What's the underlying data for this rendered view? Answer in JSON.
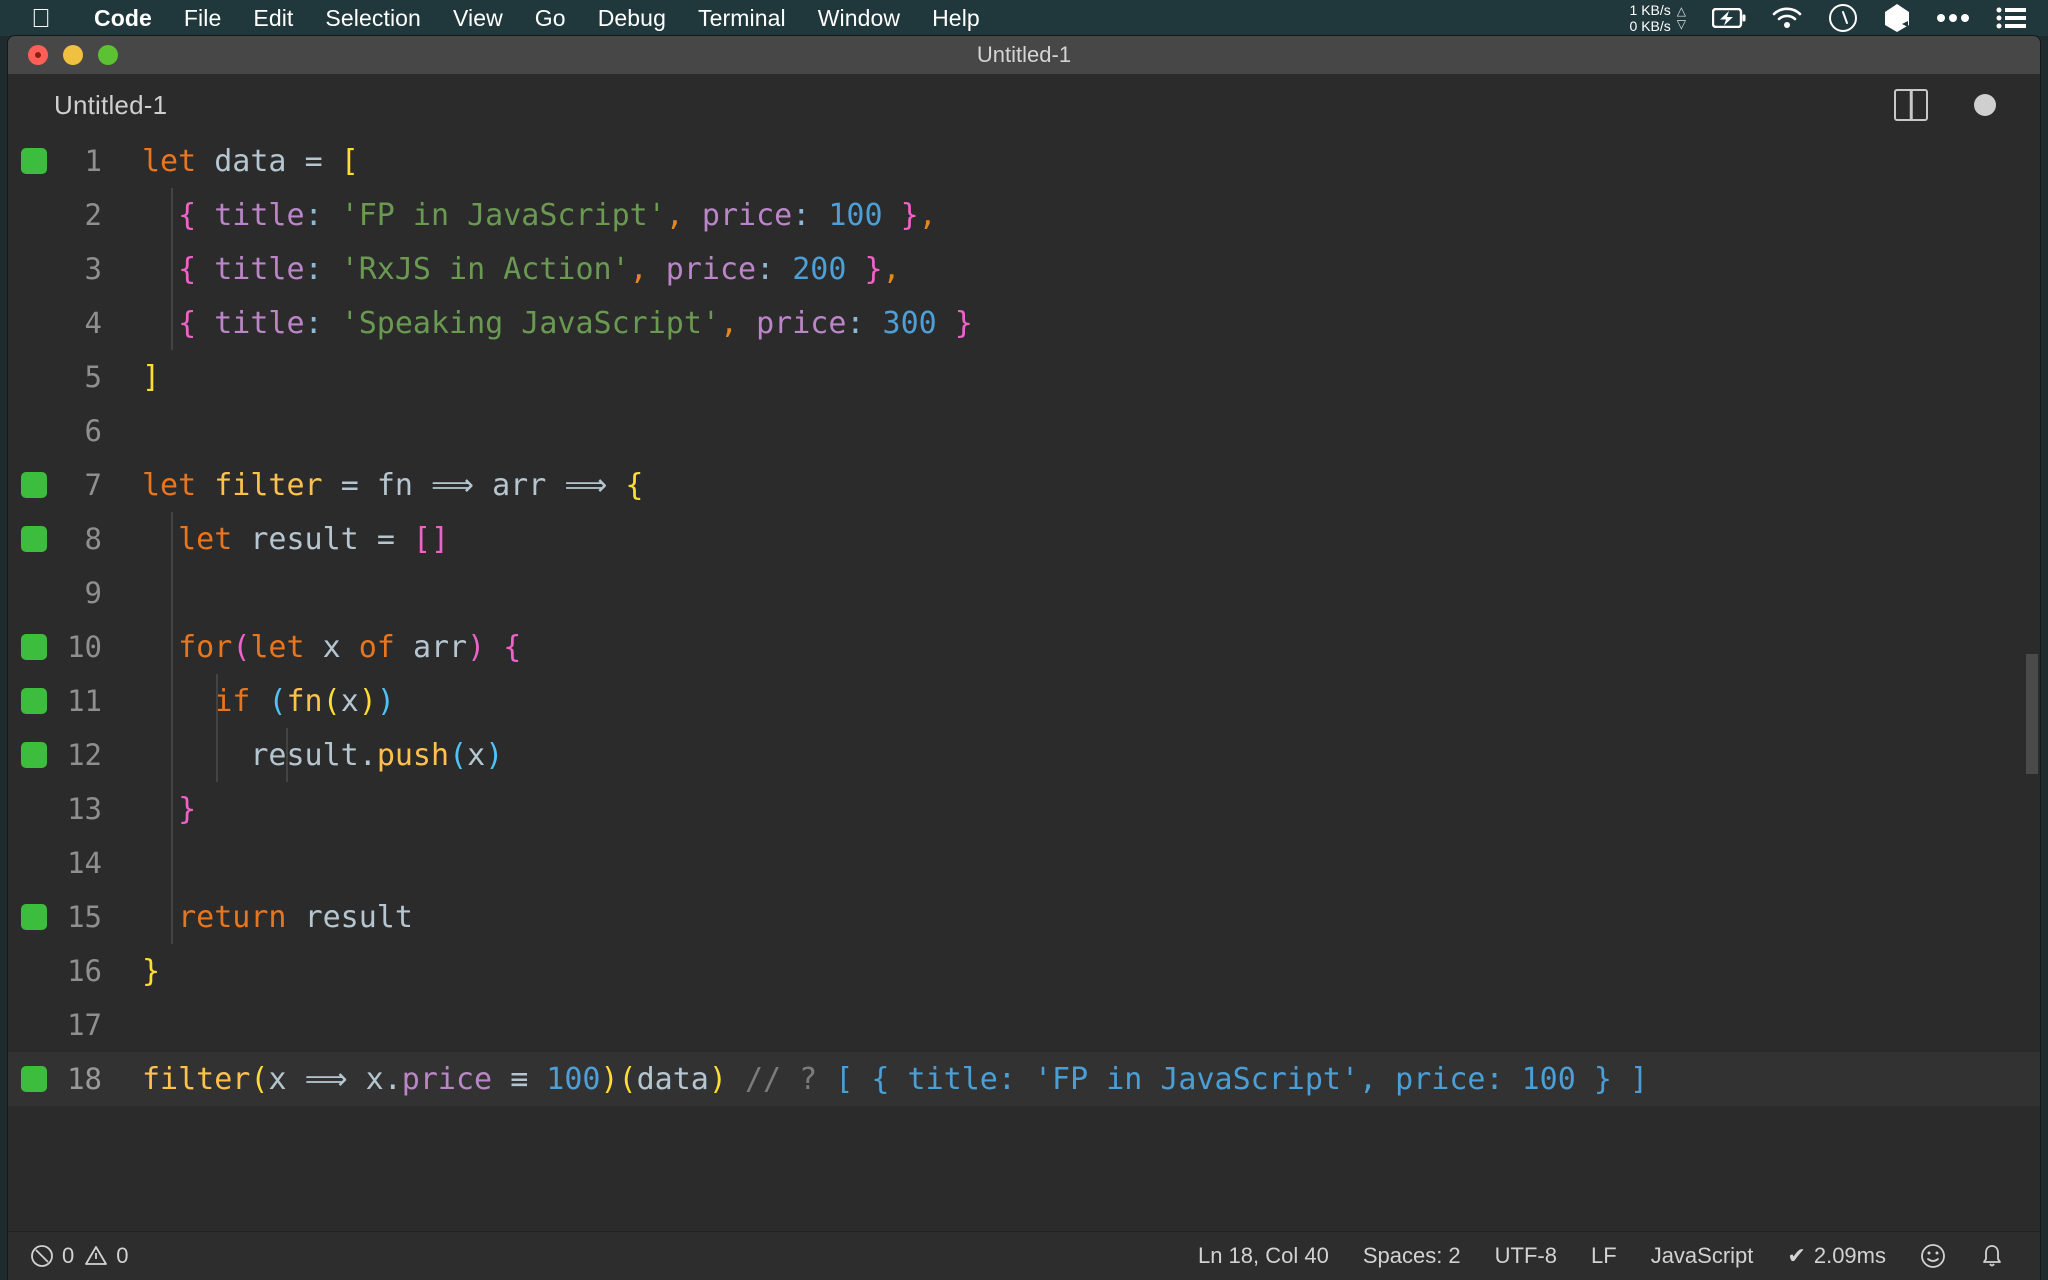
{
  "menubar": {
    "apple_icon": "apple-logo",
    "items": [
      {
        "label": "Code",
        "bold": true
      },
      {
        "label": "File",
        "bold": false
      },
      {
        "label": "Edit",
        "bold": false
      },
      {
        "label": "Selection",
        "bold": false
      },
      {
        "label": "View",
        "bold": false
      },
      {
        "label": "Go",
        "bold": false
      },
      {
        "label": "Debug",
        "bold": false
      },
      {
        "label": "Terminal",
        "bold": false
      },
      {
        "label": "Window",
        "bold": false
      },
      {
        "label": "Help",
        "bold": false
      }
    ],
    "network": {
      "upload": "1 KB/s",
      "download": "0 KB/s",
      "up_arrow": "triangle-up-icon",
      "down_arrow": "triangle-down-icon"
    },
    "status_icons": [
      "battery-charging-icon",
      "wifi-icon",
      "clock-icon",
      "dropbox-icon",
      "ellipsis-icon",
      "list-menu-icon"
    ]
  },
  "window": {
    "title": "Untitled-1",
    "traffic_lights": [
      "close-button",
      "minimize-button",
      "maximize-button"
    ]
  },
  "tabbar": {
    "title": "Untitled-1",
    "split_editor_icon": "split-editor-icon",
    "unsaved_indicator": "unsaved-dot-icon"
  },
  "editor": {
    "lines": [
      {
        "n": "1",
        "marked": true,
        "current": false,
        "guides": 0
      },
      {
        "n": "2",
        "marked": false,
        "current": false,
        "guides": 1
      },
      {
        "n": "3",
        "marked": false,
        "current": false,
        "guides": 1
      },
      {
        "n": "4",
        "marked": false,
        "current": false,
        "guides": 1
      },
      {
        "n": "5",
        "marked": false,
        "current": false,
        "guides": 0
      },
      {
        "n": "6",
        "marked": false,
        "current": false,
        "guides": 0
      },
      {
        "n": "7",
        "marked": true,
        "current": false,
        "guides": 0
      },
      {
        "n": "8",
        "marked": true,
        "current": false,
        "guides": 1
      },
      {
        "n": "9",
        "marked": false,
        "current": false,
        "guides": 1
      },
      {
        "n": "10",
        "marked": true,
        "current": false,
        "guides": 1
      },
      {
        "n": "11",
        "marked": true,
        "current": false,
        "guides": 2
      },
      {
        "n": "12",
        "marked": true,
        "current": false,
        "guides": 3
      },
      {
        "n": "13",
        "marked": false,
        "current": false,
        "guides": 2
      },
      {
        "n": "14",
        "marked": false,
        "current": false,
        "guides": 1
      },
      {
        "n": "15",
        "marked": true,
        "current": false,
        "guides": 1
      },
      {
        "n": "16",
        "marked": false,
        "current": false,
        "guides": 0
      },
      {
        "n": "17",
        "marked": false,
        "current": false,
        "guides": 0
      },
      {
        "n": "18",
        "marked": true,
        "current": true,
        "guides": 0
      }
    ],
    "source_text": [
      "let data = [",
      "  { title: 'FP in JavaScript', price: 100 },",
      "  { title: 'RxJS in Action', price: 200 },",
      "  { title: 'Speaking JavaScript', price: 300 }",
      "]",
      "",
      "let filter = fn => arr => {",
      "  let result = []",
      "",
      "  for(let x of arr) {",
      "    if (fn(x))",
      "      result.push(x)",
      "  }",
      "",
      "  return result",
      "}",
      "",
      "filter(x => x.price === 100)(data) // ? [ { title: 'FP in JavaScript', price: 100 } ]"
    ],
    "inline_result": "[ { title: 'FP in JavaScript', price: 100 } ]",
    "comment_marker": "// ?"
  },
  "statusbar": {
    "errors": "0",
    "warnings": "0",
    "error_icon": "error-circle-icon",
    "warning_icon": "warning-triangle-icon",
    "cursor_position": "Ln 18, Col 40",
    "indentation": "Spaces: 2",
    "encoding": "UTF-8",
    "eol": "LF",
    "language": "JavaScript",
    "runtime": "2.09ms",
    "runtime_check": "✔",
    "feedback_icon": "smiley-icon",
    "notifications_icon": "bell-icon"
  },
  "colors": {
    "menubar_bg": "#20383c",
    "titlebar_bg": "#474747",
    "editor_bg": "#2b2b2b",
    "current_line_bg": "#323232",
    "breakpoint_green": "#3dbd3d",
    "keyword_orange": "#e8761e",
    "function_yellow": "#ffc14d",
    "string_green": "#6a9a52",
    "property_purple": "#bb86c8",
    "number_blue": "#4d9fd6",
    "bracket_yellow": "#ffdd33",
    "bracket_magenta": "#f062c8",
    "bracket_cyan": "#4fc3f7",
    "comment_grey": "#7c7c7c"
  }
}
